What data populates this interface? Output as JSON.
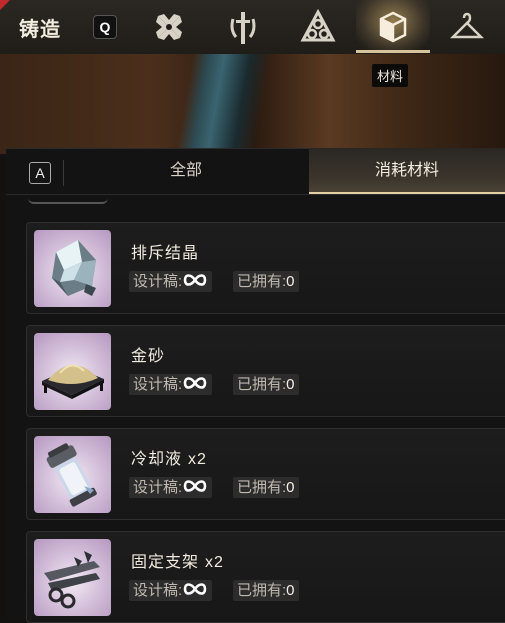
{
  "header": {
    "title": "铸造",
    "hotkey_left": "Q",
    "tabs": [
      {
        "icon": "flower-armor-icon",
        "active": false
      },
      {
        "icon": "sword-shield-icon",
        "active": false
      },
      {
        "icon": "triangle-gears-icon",
        "active": false
      },
      {
        "icon": "cube-material-icon",
        "active": true
      },
      {
        "icon": "hanger-icon",
        "active": false
      }
    ],
    "active_tooltip": "材料"
  },
  "filter": {
    "hotkey": "A",
    "tabs": [
      {
        "label": "全部",
        "active": false
      },
      {
        "label": "消耗材料",
        "active": true
      }
    ]
  },
  "labels": {
    "blueprint": "设计稿:",
    "owned": "已拥有:"
  },
  "items": [
    {
      "name": "排斥结晶",
      "qty": "",
      "blueprint": "∞",
      "owned": "0",
      "icon": "crystal-icon"
    },
    {
      "name": "金砂",
      "qty": "",
      "blueprint": "∞",
      "owned": "0",
      "icon": "gold-sand-icon"
    },
    {
      "name": "冷却液",
      "qty": "x2",
      "blueprint": "∞",
      "owned": "0",
      "icon": "coolant-icon"
    },
    {
      "name": "固定支架",
      "qty": "x2",
      "blueprint": "∞",
      "owned": "0",
      "icon": "bracket-icon"
    }
  ],
  "colors": {
    "accent": "#e2cfa4",
    "item_bg": "#1a1a1a",
    "thumb_bg": "#cdb6d6"
  }
}
